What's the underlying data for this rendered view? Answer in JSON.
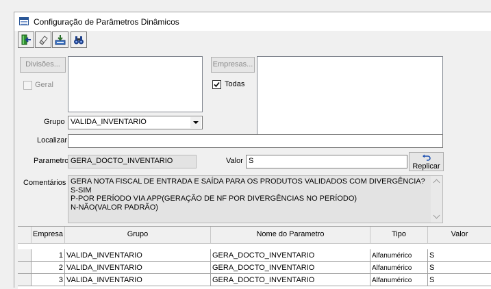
{
  "window": {
    "title": "Configuração de Parâmetros Dinâmicos"
  },
  "toolbar": {
    "buttons": [
      "exit-icon",
      "eraser-icon",
      "save-icon",
      "binoculars-icon"
    ]
  },
  "divisoes": {
    "button_label": "Divisões...",
    "geral_label": "Geral",
    "geral_checked": false
  },
  "empresas": {
    "button_label": "Empresas...",
    "todas_label": "Todas",
    "todas_checked": true
  },
  "grupo": {
    "label": "Grupo",
    "value": "VALIDA_INVENTARIO"
  },
  "localizar": {
    "label": "Localizar",
    "value": ""
  },
  "parametro": {
    "label": "Parametro",
    "value": "GERA_DOCTO_INVENTARIO"
  },
  "valor": {
    "label": "Valor",
    "value": "S"
  },
  "replicar": {
    "label": "Replicar"
  },
  "comentarios": {
    "label": "Comentários",
    "lines": [
      "GERA NOTA FISCAL DE ENTRADA E SAÍDA PARA OS PRODUTOS VALIDADOS COM DIVERGÊNCIA?",
      "S-SIM",
      "P-POR PERÍODO VIA APP(GERAÇÃO DE NF POR DIVERGÊNCIAS NO PERÍODO)",
      "N-NÃO(VALOR PADRÃO)"
    ]
  },
  "table": {
    "headers": [
      "Empresa",
      "Grupo",
      "Nome do Parametro",
      "Tipo",
      "Valor"
    ],
    "rows": [
      [
        "1",
        "VALIDA_INVENTARIO",
        "GERA_DOCTO_INVENTARIO",
        "Alfanumérico",
        "S"
      ],
      [
        "2",
        "VALIDA_INVENTARIO",
        "GERA_DOCTO_INVENTARIO",
        "Alfanumérico",
        "S"
      ],
      [
        "3",
        "VALIDA_INVENTARIO",
        "GERA_DOCTO_INVENTARIO",
        "Alfanumérico",
        "S"
      ]
    ]
  }
}
